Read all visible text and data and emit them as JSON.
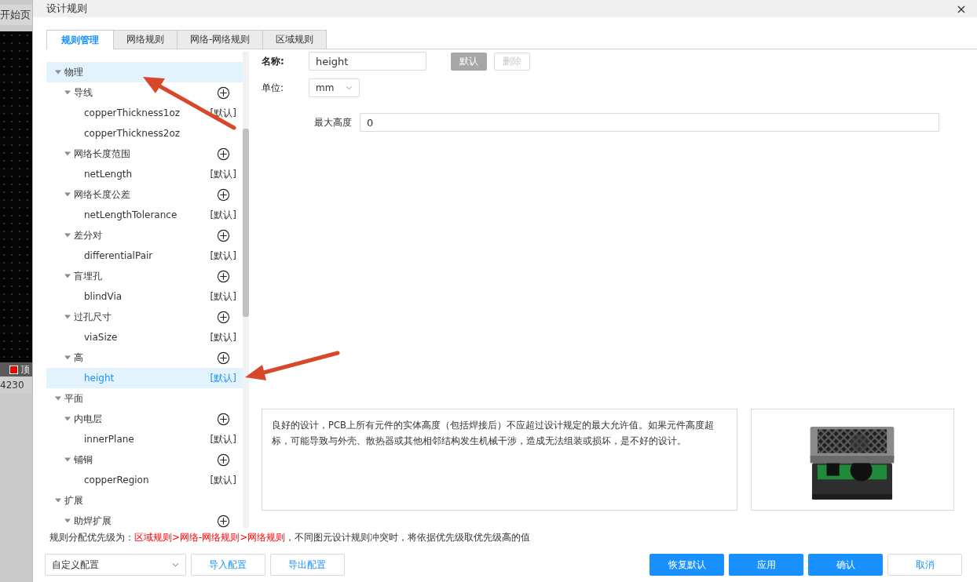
{
  "background_app": {
    "tab": "开始页",
    "layer_tab": "顶",
    "coordinate": "4230"
  },
  "window": {
    "title": "设计规则",
    "close": "×"
  },
  "tabs": [
    {
      "label": "规则管理",
      "selected": true
    },
    {
      "label": "网络规则",
      "selected": false
    },
    {
      "label": "网络-网络规则",
      "selected": false
    },
    {
      "label": "区域规则",
      "selected": false
    }
  ],
  "tree": [
    {
      "kind": "category",
      "label": "物理",
      "expanded": true,
      "hovered": true,
      "children": [
        {
          "kind": "group",
          "label": "导线",
          "expanded": true,
          "children": [
            {
              "kind": "rule",
              "label": "copperThickness1oz",
              "tag": "[默认]",
              "selected": false
            },
            {
              "kind": "rule",
              "label": "copperThickness2oz",
              "selected": false
            }
          ]
        },
        {
          "kind": "group",
          "label": "网络长度范围",
          "expanded": true,
          "children": [
            {
              "kind": "rule",
              "label": "netLength",
              "tag": "[默认]",
              "selected": false
            }
          ]
        },
        {
          "kind": "group",
          "label": "网络长度公差",
          "expanded": true,
          "children": [
            {
              "kind": "rule",
              "label": "netLengthTolerance",
              "tag": "[默认]",
              "selected": false
            }
          ]
        },
        {
          "kind": "group",
          "label": "差分对",
          "expanded": true,
          "children": [
            {
              "kind": "rule",
              "label": "differentialPair",
              "tag": "[默认]",
              "selected": false
            }
          ]
        },
        {
          "kind": "group",
          "label": "盲埋孔",
          "expanded": true,
          "children": [
            {
              "kind": "rule",
              "label": "blindVia",
              "tag": "[默认]",
              "selected": false
            }
          ]
        },
        {
          "kind": "group",
          "label": "过孔尺寸",
          "expanded": true,
          "children": [
            {
              "kind": "rule",
              "label": "viaSize",
              "tag": "[默认]",
              "selected": false
            }
          ]
        },
        {
          "kind": "group",
          "label": "高",
          "expanded": true,
          "children": [
            {
              "kind": "rule",
              "label": "height",
              "tag": "[默认]",
              "selected": true
            }
          ]
        }
      ]
    },
    {
      "kind": "category",
      "label": "平面",
      "expanded": true,
      "hovered": false,
      "children": [
        {
          "kind": "group",
          "label": "内电层",
          "expanded": true,
          "children": [
            {
              "kind": "rule",
              "label": "innerPlane",
              "tag": "[默认]",
              "selected": false
            }
          ]
        },
        {
          "kind": "group",
          "label": "铺铜",
          "expanded": true,
          "children": [
            {
              "kind": "rule",
              "label": "copperRegion",
              "tag": "[默认]",
              "selected": false
            }
          ]
        }
      ]
    },
    {
      "kind": "category",
      "label": "扩展",
      "expanded": true,
      "hovered": false,
      "children": [
        {
          "kind": "group",
          "label": "助焊扩展",
          "expanded": true
        }
      ]
    }
  ],
  "form": {
    "name_label": "名称:",
    "name_value": "height",
    "buttons": [
      {
        "label": "默认",
        "kind": "filled",
        "disabled": true
      },
      {
        "label": "删除",
        "kind": "outline",
        "disabled": true
      }
    ],
    "unit_label": "单位:",
    "unit_value": "mm",
    "param_label": "最大高度",
    "param_value": "0"
  },
  "description": "良好的设计，PCB上所有元件的实体高度（包括焊接后）不应超过设计规定的最大允许值。如果元件高度超标，可能导致与外壳、散热器或其他相邻结构发生机械干涉，造成无法组装或损坏，是不好的设计。",
  "priority": {
    "prefix": "规则分配优先级为：",
    "highlight": "区域规则>网络-网络规则>网络规则",
    "suffix": "，不同图元设计规则冲突时，将依据优先级取优先级高的值"
  },
  "footer": {
    "config": "自定义配置",
    "left_buttons": [
      {
        "label": "导入配置",
        "kind": "outline"
      },
      {
        "label": "导出配置",
        "kind": "outline"
      }
    ],
    "right_buttons": [
      {
        "label": "恢复默认",
        "kind": "primary"
      },
      {
        "label": "应用",
        "kind": "primary"
      },
      {
        "label": "确认",
        "kind": "primary"
      },
      {
        "label": "取消",
        "kind": "outline"
      }
    ]
  }
}
